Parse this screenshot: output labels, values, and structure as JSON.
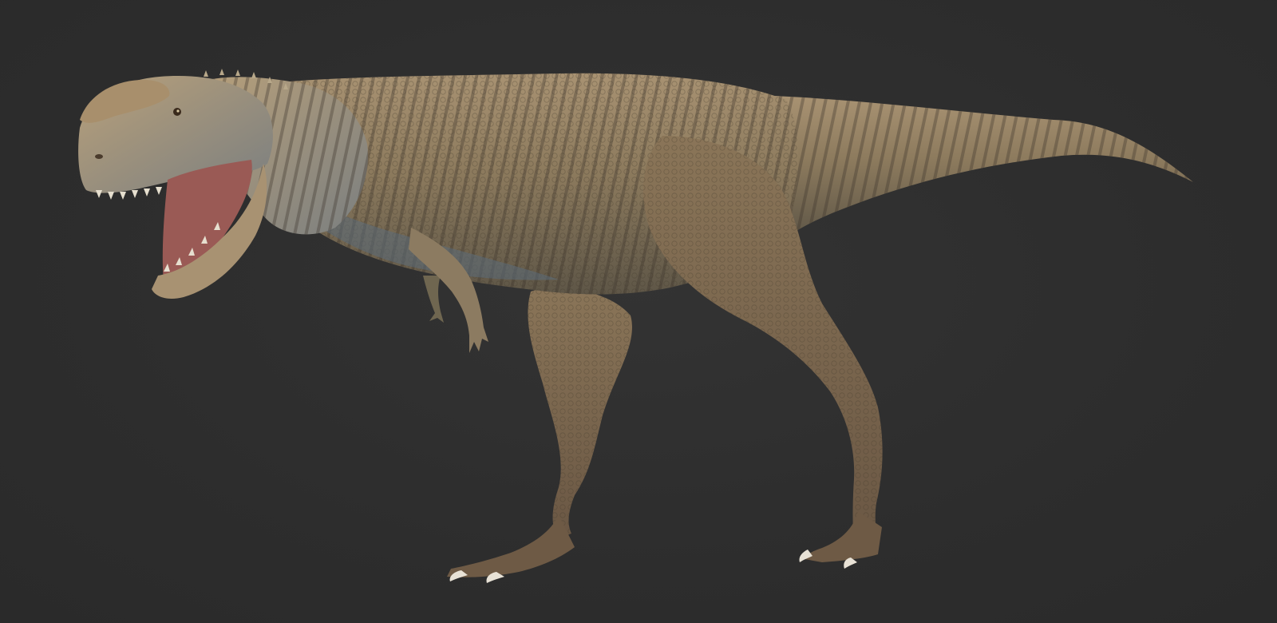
{
  "scene": {
    "subject": "dinosaur-render",
    "colors": {
      "background": "#2e2e2e",
      "skin_light": "#b3a07c",
      "skin_mid": "#8f7b5c",
      "skin_dark": "#5f5140",
      "belly_blue": "#5b6b7a",
      "mouth": "#9a5a55",
      "claw": "#e8e2d6"
    }
  }
}
